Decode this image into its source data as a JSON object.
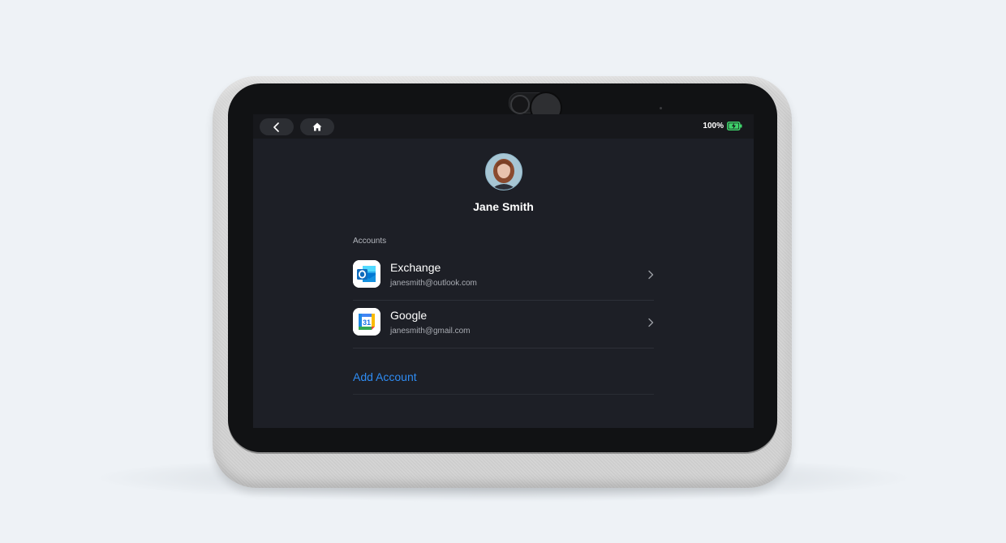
{
  "status_bar": {
    "battery_text": "100%",
    "battery_level": 1.0,
    "battery_color": "#3fd46b"
  },
  "nav": {
    "back_icon": "chevron-left-icon",
    "home_icon": "home-icon"
  },
  "profile": {
    "name": "Jane Smith"
  },
  "accounts": {
    "section_label": "Accounts",
    "items": [
      {
        "provider": "Exchange",
        "email": "janesmith@outlook.com",
        "icon": "outlook-icon"
      },
      {
        "provider": "Google",
        "email": "janesmith@gmail.com",
        "icon": "google-calendar-icon",
        "icon_text": "31"
      }
    ],
    "add_label": "Add Account"
  },
  "colors": {
    "screen_bg": "#1d1f26",
    "topbar_bg": "#17181c",
    "accent": "#2f8cf3",
    "outlook_blue": "#0f6cbd"
  }
}
